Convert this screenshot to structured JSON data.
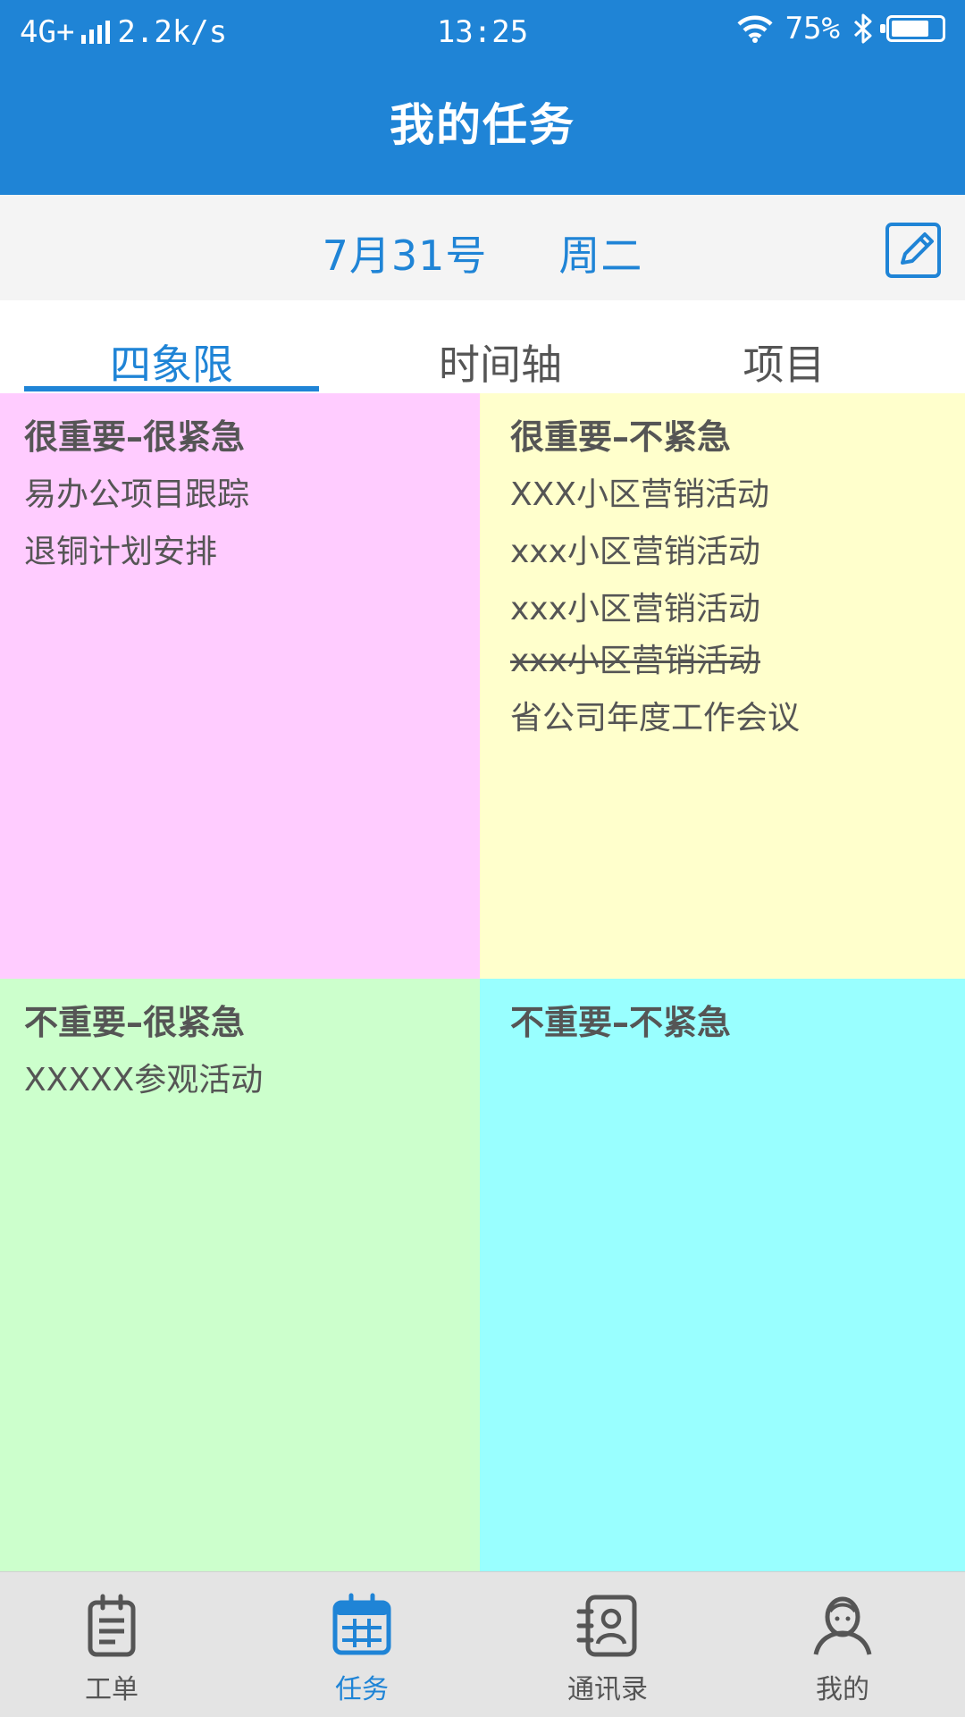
{
  "status_bar": {
    "network": "4G+",
    "speed": "2.2k/s",
    "time": "13:25",
    "battery": "75%",
    "battery_level": 0.75
  },
  "header": {
    "title": "我的任务"
  },
  "date_bar": {
    "date": "7月31号",
    "weekday": "周二"
  },
  "tabs": [
    {
      "label": "四象限",
      "active": true
    },
    {
      "label": "时间轴",
      "active": false
    },
    {
      "label": "项目",
      "active": false
    }
  ],
  "quadrants": [
    {
      "title": "很重要–很紧急",
      "color": "#ffccff",
      "items": [
        {
          "text": "易办公项目跟踪",
          "done": false
        },
        {
          "text": "退铜计划安排",
          "done": false
        }
      ]
    },
    {
      "title": "很重要–不紧急",
      "color": "#ffffcc",
      "items": [
        {
          "text": "XXX小区营销活动",
          "done": false
        },
        {
          "text": "xxx小区营销活动",
          "done": false
        },
        {
          "text": "xxx小区营销活动",
          "done": false
        },
        {
          "text": "xxx小区营销活动",
          "done": true
        },
        {
          "text": "省公司年度工作会议",
          "done": false
        }
      ]
    },
    {
      "title": "不重要–很紧急",
      "color": "#ccffcc",
      "items": [
        {
          "text": "XXXXX参观活动",
          "done": false
        }
      ]
    },
    {
      "title": "不重要–不紧急",
      "color": "#99ffff",
      "items": []
    }
  ],
  "bottom_nav": [
    {
      "label": "工单",
      "icon": "clipboard-icon",
      "active": false
    },
    {
      "label": "任务",
      "icon": "calendar-icon",
      "active": true
    },
    {
      "label": "通讯录",
      "icon": "contacts-icon",
      "active": false
    },
    {
      "label": "我的",
      "icon": "user-icon",
      "active": false
    }
  ],
  "colors": {
    "primary": "#1f84d6",
    "text": "#555555",
    "nav_bg": "#e4e4e4"
  }
}
